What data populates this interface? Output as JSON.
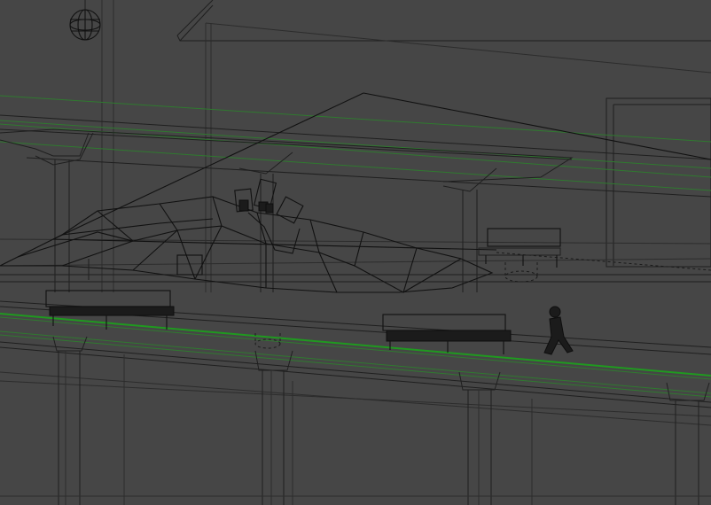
{
  "viewport": {
    "shading": "wireframe",
    "background_color": "#464646",
    "wire_color": "#1f1f1f",
    "highlight_edge_color": "#2f7a2f"
  },
  "objects": [
    "pendant-lamp",
    "station-building",
    "platform-canopy",
    "canopy-pillar",
    "terrain-mesh",
    "camera-rig",
    "bench",
    "trash-bin",
    "walking-person",
    "platform-edge",
    "support-column"
  ]
}
